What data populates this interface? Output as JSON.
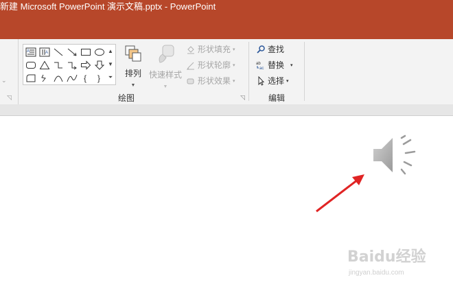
{
  "window": {
    "title": "新建 Microsoft PowerPoint 演示文稿.pptx  -  PowerPoint",
    "accent": "#b7472a"
  },
  "ribbon": {
    "drawing_group": {
      "label": "绘图",
      "arrange_label": "排列",
      "quick_styles_label": "快速样式",
      "shape_fill_label": "形状填充",
      "shape_outline_label": "形状轮廓",
      "shape_effects_label": "形状效果"
    },
    "editing_group": {
      "label": "编辑",
      "find_label": "查找",
      "replace_label": "替换",
      "select_label": "选择"
    }
  },
  "slide": {
    "audio_icon": "speaker-icon",
    "annotation": "red-arrow"
  },
  "watermark": {
    "logo": "Baidu经验",
    "url": "jingyan.baidu.com"
  }
}
